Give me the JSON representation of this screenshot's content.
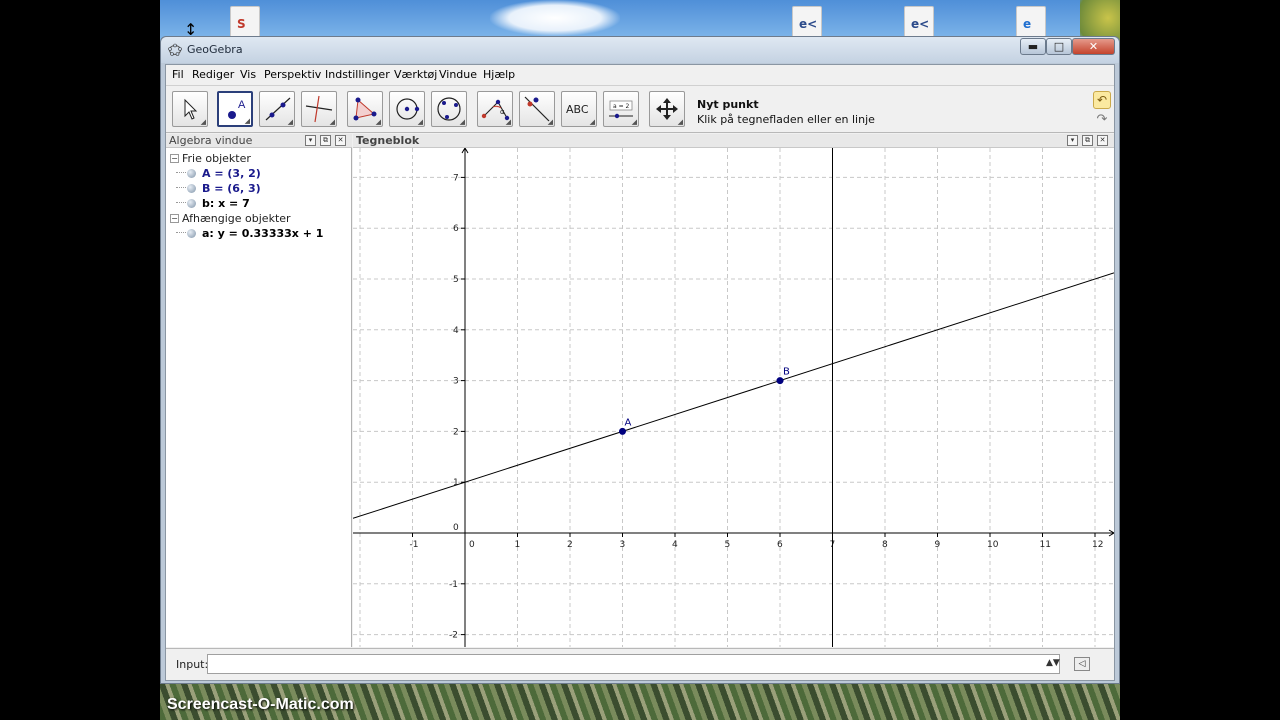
{
  "window": {
    "title": "GeoGebra",
    "minimize": "▬",
    "maximize": "□",
    "close": "✕"
  },
  "menu": [
    "Fil",
    "Rediger",
    "Vis",
    "Perspektiv",
    "Indstillinger",
    "Værktøj",
    "Vindue",
    "Hjælp"
  ],
  "toolbar": {
    "tools": [
      "move-tool",
      "new-point-tool",
      "line-through-two-points-tool",
      "perpendicular-line-tool",
      "polygon-tool",
      "circle-with-center-tool",
      "circle-through-three-points-tool",
      "angle-tool",
      "reflect-about-line-tool",
      "text-tool",
      "slider-tool",
      "move-graphics-view-tool"
    ],
    "selected_tool": "new-point-tool",
    "text_tool_label": "ABC",
    "slider_tool_label": "a = 2",
    "help_title": "Nyt punkt",
    "help_text": "Klik på tegnefladen eller en linje"
  },
  "algebra": {
    "title": "Algebra vindue",
    "free_label": "Frie objekter",
    "free_objects": [
      "A = (3, 2)",
      "B = (6, 3)",
      "b: x = 7"
    ],
    "dependent_label": "Afhængige objekter",
    "dependent_objects": [
      "a: y = 0.33333x + 1"
    ]
  },
  "graphics": {
    "title": "Tegneblok",
    "x_ticks": [
      "-1",
      "0",
      "1",
      "2",
      "3",
      "4",
      "5",
      "6",
      "7",
      "8",
      "9",
      "10",
      "11",
      "12"
    ],
    "y_ticks": [
      "7",
      "6",
      "5",
      "4",
      "3",
      "2",
      "1",
      "0",
      "-1",
      "-2"
    ],
    "point_A_label": "A",
    "point_B_label": "B",
    "points": [
      {
        "name": "A",
        "x": 3,
        "y": 2
      },
      {
        "name": "B",
        "x": 6,
        "y": 3
      }
    ],
    "line_a": {
      "slope": 0.33333,
      "intercept": 1
    },
    "vertical_line_b": 7,
    "x_range": [
      -2.1,
      12.2
    ],
    "y_range": [
      -2.2,
      7.7
    ],
    "point_color": "#00007f"
  },
  "input": {
    "label": "Input:",
    "value": ""
  },
  "desktop": {
    "watermark": "Screencast-O-Matic.com"
  }
}
